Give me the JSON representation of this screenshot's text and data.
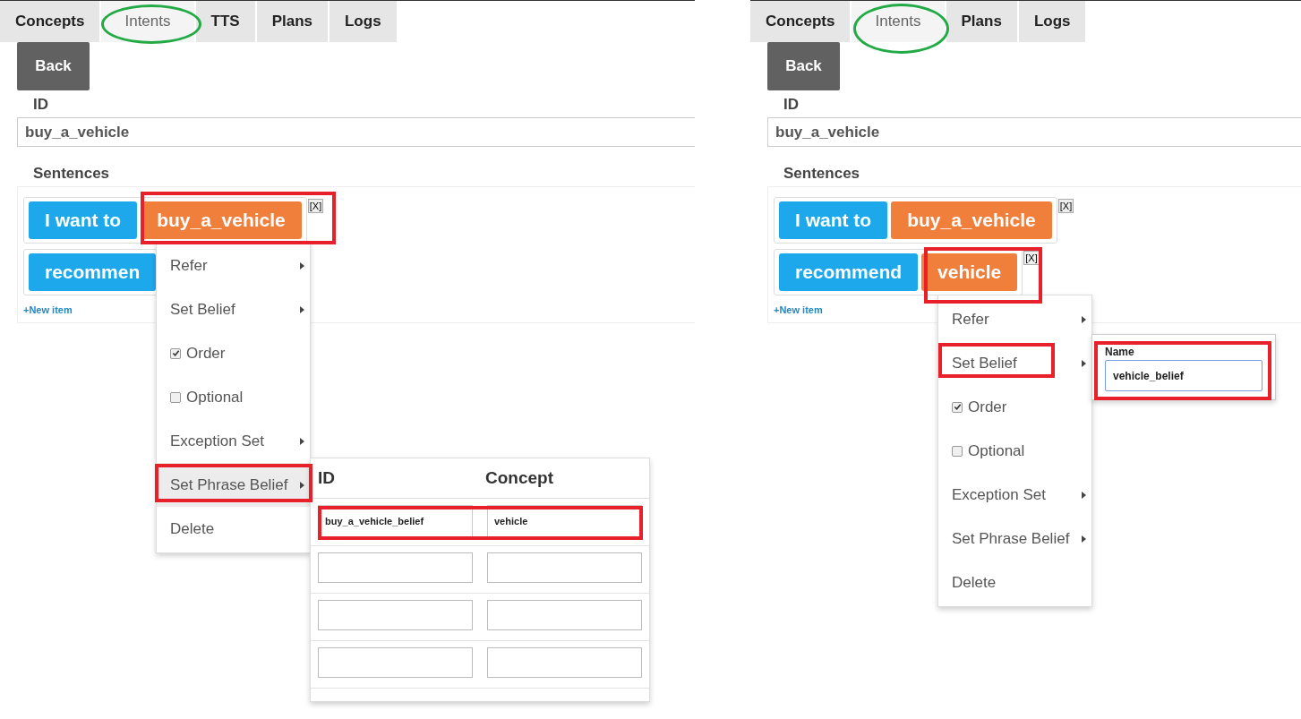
{
  "panels": [
    {
      "tabs": [
        {
          "label": "Concepts",
          "selected": false
        },
        {
          "label": "Intents",
          "selected": true
        },
        {
          "label": "TTS",
          "selected": false
        },
        {
          "label": "Plans",
          "selected": false
        },
        {
          "label": "Logs",
          "selected": false
        }
      ],
      "back_button": "Back",
      "id_label": "ID",
      "id_value": "buy_a_vehicle",
      "sentences_label": "Sentences",
      "sentences": [
        {
          "chips": [
            {
              "text": "I want to",
              "kind": "word"
            },
            {
              "text": "buy_a_vehicle",
              "kind": "concept"
            }
          ],
          "remove": "[X]"
        },
        {
          "chips": [
            {
              "text": "recommen",
              "kind": "word"
            }
          ]
        }
      ],
      "new_item": "+New item",
      "menu": {
        "items": [
          {
            "label": "Refer",
            "kind": "submenu",
            "highlighted": false
          },
          {
            "label": "Set Belief",
            "kind": "submenu",
            "highlighted": false
          },
          {
            "label": "Order",
            "kind": "checkbox",
            "checked": true,
            "highlighted": false
          },
          {
            "label": "Optional",
            "kind": "checkbox",
            "checked": false,
            "highlighted": false
          },
          {
            "label": "Exception Set",
            "kind": "submenu",
            "highlighted": false
          },
          {
            "label": "Set Phrase Belief",
            "kind": "submenu",
            "highlighted": true
          },
          {
            "label": "Delete",
            "kind": "plain",
            "highlighted": false
          }
        ]
      },
      "popup": {
        "kind": "table",
        "columns": [
          "ID",
          "Concept"
        ],
        "rows": [
          {
            "kind": "filled",
            "id": "buy_a_vehicle_belief",
            "concept": "vehicle"
          },
          {
            "kind": "empty"
          },
          {
            "kind": "empty"
          },
          {
            "kind": "empty"
          }
        ]
      }
    },
    {
      "tabs": [
        {
          "label": "Concepts",
          "selected": false
        },
        {
          "label": "Intents",
          "selected": true
        },
        {
          "label": "Plans",
          "selected": false
        },
        {
          "label": "Logs",
          "selected": false
        }
      ],
      "back_button": "Back",
      "id_label": "ID",
      "id_value": "buy_a_vehicle",
      "sentences_label": "Sentences",
      "sentences": [
        {
          "chips": [
            {
              "text": "I want to",
              "kind": "word"
            },
            {
              "text": "buy_a_vehicle",
              "kind": "concept"
            }
          ],
          "remove": "[X]"
        },
        {
          "chips": [
            {
              "text": "recommend",
              "kind": "word"
            },
            {
              "text": "vehicle",
              "kind": "concept"
            }
          ],
          "remove": "[X]"
        }
      ],
      "new_item": "+New item",
      "menu": {
        "items": [
          {
            "label": "Refer",
            "kind": "submenu",
            "highlighted": false
          },
          {
            "label": "Set Belief",
            "kind": "submenu",
            "highlighted": false
          },
          {
            "label": "Order",
            "kind": "checkbox",
            "checked": true,
            "highlighted": false
          },
          {
            "label": "Optional",
            "kind": "checkbox",
            "checked": false,
            "highlighted": false
          },
          {
            "label": "Exception Set",
            "kind": "submenu",
            "highlighted": false
          },
          {
            "label": "Set Phrase Belief",
            "kind": "submenu",
            "highlighted": false
          },
          {
            "label": "Delete",
            "kind": "plain",
            "highlighted": false
          }
        ]
      },
      "popup": {
        "kind": "name",
        "label": "Name",
        "value": "vehicle_belief"
      }
    }
  ]
}
